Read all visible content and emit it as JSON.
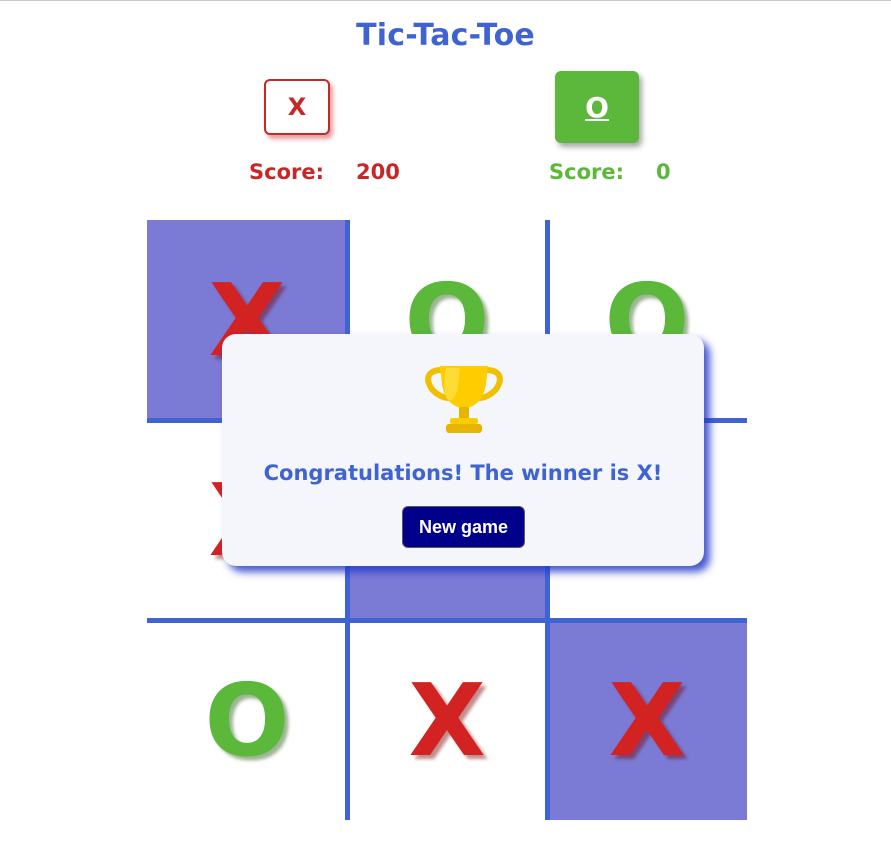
{
  "title": "Tic-Tac-Toe",
  "players": {
    "x": {
      "label": "X",
      "score_label": "Score:",
      "score": "200"
    },
    "o": {
      "label": "O",
      "score_label": "Score:",
      "score": "0"
    }
  },
  "board": {
    "cells": [
      {
        "mark": "X",
        "highlighted": true
      },
      {
        "mark": "O",
        "highlighted": false
      },
      {
        "mark": "O",
        "highlighted": false
      },
      {
        "mark": "X",
        "highlighted": false
      },
      {
        "mark": "",
        "highlighted": true
      },
      {
        "mark": "",
        "highlighted": false
      },
      {
        "mark": "O",
        "highlighted": false
      },
      {
        "mark": "X",
        "highlighted": false
      },
      {
        "mark": "X",
        "highlighted": true
      }
    ]
  },
  "modal": {
    "icon": "trophy-icon",
    "message": "Congratulations! The winner is X!",
    "button_label": "New game"
  },
  "colors": {
    "accent": "#3f63d3",
    "x": "#c62828",
    "o": "#5cb83a",
    "highlight": "#7b7bd6",
    "button": "#00008a"
  }
}
